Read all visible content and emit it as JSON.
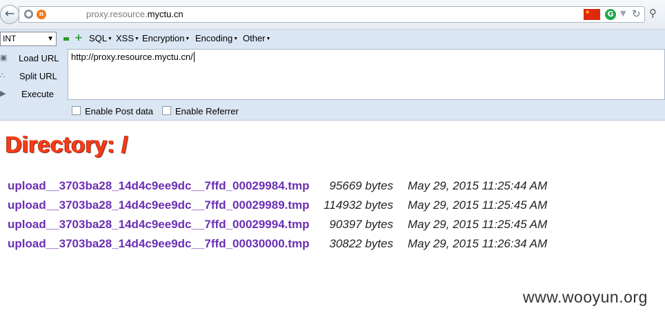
{
  "browser": {
    "url_prefix": "proxy.resource.",
    "url_domain": "myctu.cn",
    "site_icon": "n",
    "icons": [
      "back-arrow-icon",
      "globe-icon",
      "site-icon",
      "china-flag-icon",
      "g-extension-icon",
      "dropdown-arrow-icon",
      "reload-icon",
      "search-icon"
    ]
  },
  "hackbar": {
    "select_value": "INT",
    "menus": [
      "SQL",
      "XSS",
      "Encryption",
      "Encoding",
      "Other"
    ],
    "buttons": {
      "load_url": "Load URL",
      "split_url": "Split URL",
      "execute": "Execute"
    },
    "url_value": "http://proxy.resource.myctu.cn/",
    "checkboxes": {
      "post": "Enable Post data",
      "referrer": "Enable Referrer"
    }
  },
  "page": {
    "title": "Directory: /",
    "files": [
      {
        "name": "upload__3703ba28_14d4c9ee9dc__7ffd_00029984.tmp",
        "size": "95669 bytes",
        "date": "May 29, 2015 11:25:44 AM"
      },
      {
        "name": "upload__3703ba28_14d4c9ee9dc__7ffd_00029989.tmp",
        "size": "114932 bytes",
        "date": "May 29, 2015 11:25:45 AM"
      },
      {
        "name": "upload__3703ba28_14d4c9ee9dc__7ffd_00029994.tmp",
        "size": "90397 bytes",
        "date": "May 29, 2015 11:25:45 AM"
      },
      {
        "name": "upload__3703ba28_14d4c9ee9dc__7ffd_00030000.tmp",
        "size": "30822 bytes",
        "date": "May 29, 2015 11:26:34 AM"
      }
    ]
  },
  "watermark": "www.wooyun.org",
  "colors": {
    "title": "#ff3b16",
    "link": "#6b2fb3",
    "hackbar_bg": "#dbe6f4"
  }
}
